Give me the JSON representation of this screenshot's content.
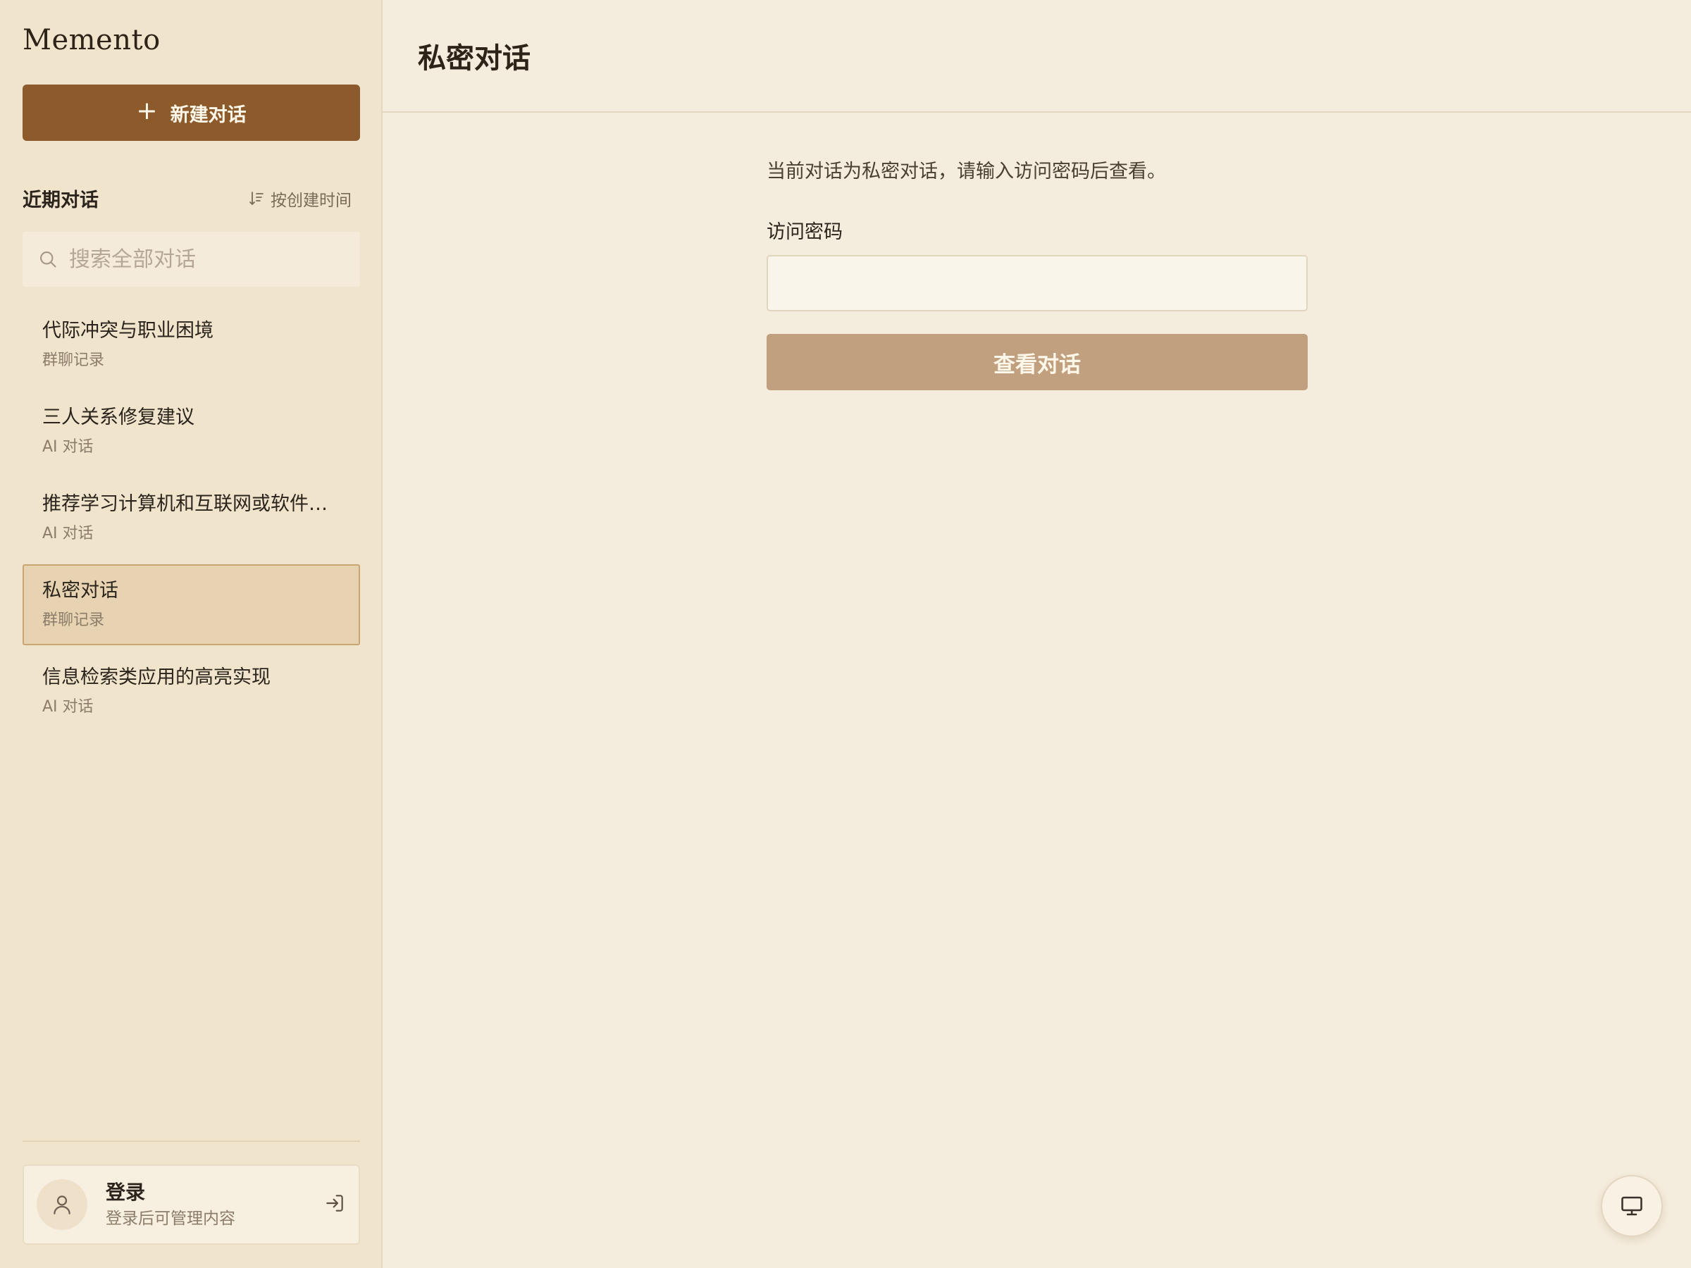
{
  "app": {
    "brand": "Memento"
  },
  "sidebar": {
    "new_chat_label": "新建对话",
    "recent_title": "近期对话",
    "sort_label": "按创建时间",
    "search_placeholder": "搜索全部对话",
    "conversations": [
      {
        "title": "代际冲突与职业困境",
        "type": "群聊记录",
        "active": false
      },
      {
        "title": "三人关系修复建议",
        "type": "AI 对话",
        "active": false
      },
      {
        "title": "推荐学习计算机和互联网或软件…",
        "type": "AI 对话",
        "active": false
      },
      {
        "title": "私密对话",
        "type": "群聊记录",
        "active": true
      },
      {
        "title": "信息检索类应用的高亮实现",
        "type": "AI 对话",
        "active": false
      }
    ],
    "login": {
      "title": "登录",
      "subtitle": "登录后可管理内容"
    }
  },
  "main": {
    "title": "私密对话",
    "notice": "当前对话为私密对话，请输入访问密码后查看。",
    "password_label": "访问密码",
    "password_value": "",
    "submit_label": "查看对话"
  },
  "colors": {
    "accent": "#8c5a2b",
    "submit_disabled": "#c0a07e",
    "active_item": "#e7d3b2",
    "sidebar_bg": "#f0e4cd",
    "main_bg": "#f4ecdc"
  },
  "icons": {
    "new_chat": "plus-icon",
    "sort": "sort-icon",
    "search": "search-icon",
    "avatar": "user-icon",
    "login": "login-icon",
    "fab": "monitor-icon"
  }
}
